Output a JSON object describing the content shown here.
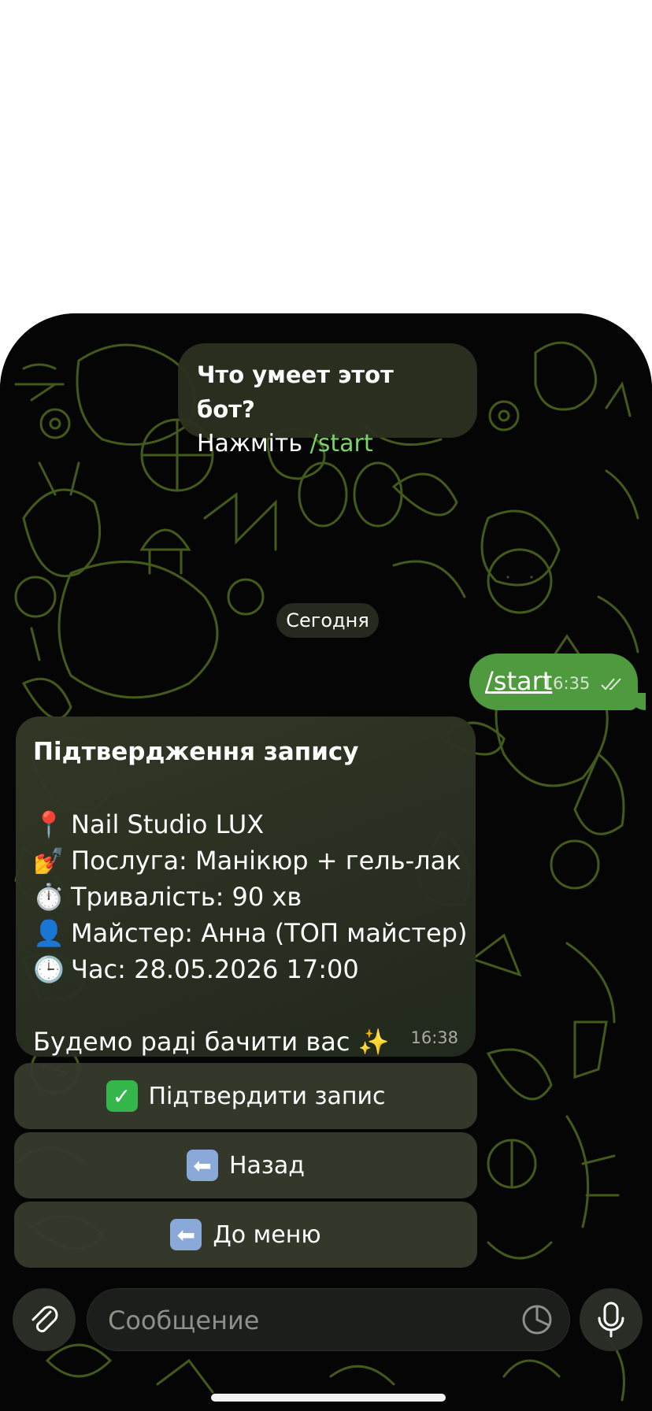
{
  "bot_info": {
    "question": "Что умеет этот бот?",
    "prompt": "Нажміть ",
    "command": "/start"
  },
  "date_chip": "Сегодня",
  "outgoing": {
    "text": "/start",
    "time": "16:35",
    "status_icon": "double-check-icon"
  },
  "incoming": {
    "title": "Підтвердження запису",
    "lines": [
      {
        "emoji": "📍",
        "text": "Nail Studio LUX"
      },
      {
        "emoji": "💅",
        "text": "Послуга: Манікюр + гель-лак"
      },
      {
        "emoji": "⏱️",
        "text": "Тривалість: 90 хв"
      },
      {
        "emoji": "👤",
        "text": "Майстер: Анна (ТОП майстер)"
      },
      {
        "emoji": "🕒",
        "text": "Час: 28.05.2026 17:00"
      }
    ],
    "footer_text": "Будемо раді бачити вас ✨",
    "time": "16:38"
  },
  "keyboard": [
    {
      "emoji": "✅",
      "label": "Підтвердити запис",
      "emoji_color": "#35b64a"
    },
    {
      "emoji": "⬅",
      "label": "Назад",
      "emoji_color": "#8aa8d8"
    },
    {
      "emoji": "⬅",
      "label": "До меню",
      "emoji_color": "#8aa8d8"
    }
  ],
  "input": {
    "placeholder": "Сообщение",
    "attach_icon": "paperclip-icon",
    "sticker_icon": "sticker-icon",
    "mic_icon": "microphone-icon"
  },
  "colors": {
    "accent_green": "#4f9a3e",
    "command_green": "#7bd26a",
    "wallpaper_line": "#4e6a1e"
  }
}
